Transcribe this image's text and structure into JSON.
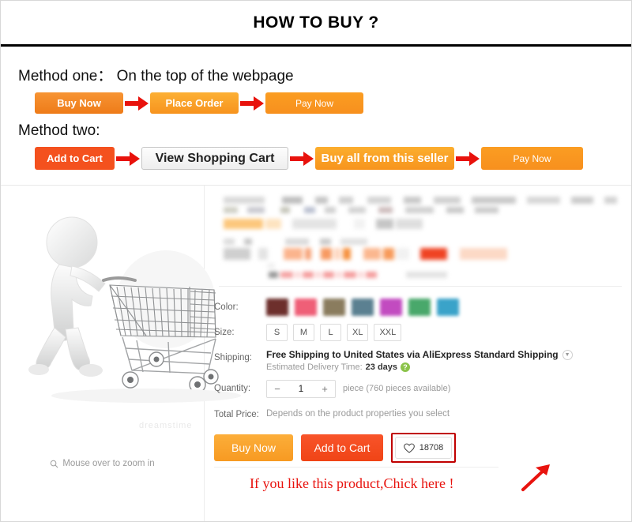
{
  "header": {
    "title": "HOW TO BUY ?"
  },
  "method_one": {
    "label": "Method one： On the top of the webpage",
    "steps": [
      {
        "label": "Buy Now",
        "icon": "arrow-right-icon"
      },
      {
        "label": "Place Order",
        "icon": "arrow-right-icon"
      },
      {
        "label": "Pay Now"
      }
    ]
  },
  "method_two": {
    "label": "Method two:",
    "steps": [
      {
        "label": "Add to Cart",
        "icon": "arrow-right-icon"
      },
      {
        "label": "View Shopping Cart",
        "icon": "arrow-right-icon"
      },
      {
        "label": "Buy all from this seller",
        "icon": "arrow-right-icon"
      },
      {
        "label": "Pay Now"
      }
    ]
  },
  "product": {
    "image": {
      "alt": "3d-character-pushing-shopping-cart",
      "watermark": "dreamstime",
      "zoom_hint": "Mouse over to zoom in",
      "zoom_icon": "magnifier-icon"
    },
    "options": {
      "color_label": "Color:",
      "color_swatches": [
        "#6d2f2c",
        "#ef5f77",
        "#8a7c5e",
        "#5b8091",
        "#c24bc0",
        "#49a86b",
        "#3aa3c9"
      ],
      "size_label": "Size:",
      "sizes": [
        "S",
        "M",
        "L",
        "XL",
        "XXL"
      ],
      "shipping_label": "Shipping:",
      "shipping_value": "Free Shipping to United States via AliExpress Standard Shipping",
      "shipping_chevron_icon": "chevron-down-icon",
      "delivery_prefix": "Estimated Delivery Time:",
      "delivery_value": "23 days",
      "delivery_help_icon": "question-mark-icon",
      "quantity_label": "Quantity:",
      "quantity_minus": "−",
      "quantity_value": "1",
      "quantity_plus": "+",
      "quantity_unit": "piece (760 pieces available)",
      "total_label": "Total Price:",
      "total_value": "Depends on the product properties you select"
    },
    "actions": {
      "buy_now": "Buy Now",
      "add_to_cart": "Add to Cart",
      "favorite_icon": "heart-icon",
      "favorite_count": "18708"
    }
  },
  "annotation": {
    "text": "If you like this product,Chick here !",
    "arrow_icon": "arrow-up-right-icon",
    "color": "#e8130e"
  },
  "colors": {
    "title_bar_border": "#000000",
    "orange": "#f7941d",
    "red_orange": "#f4511e",
    "arrow_red": "#e8120c",
    "highlight_box": "#c00000"
  }
}
